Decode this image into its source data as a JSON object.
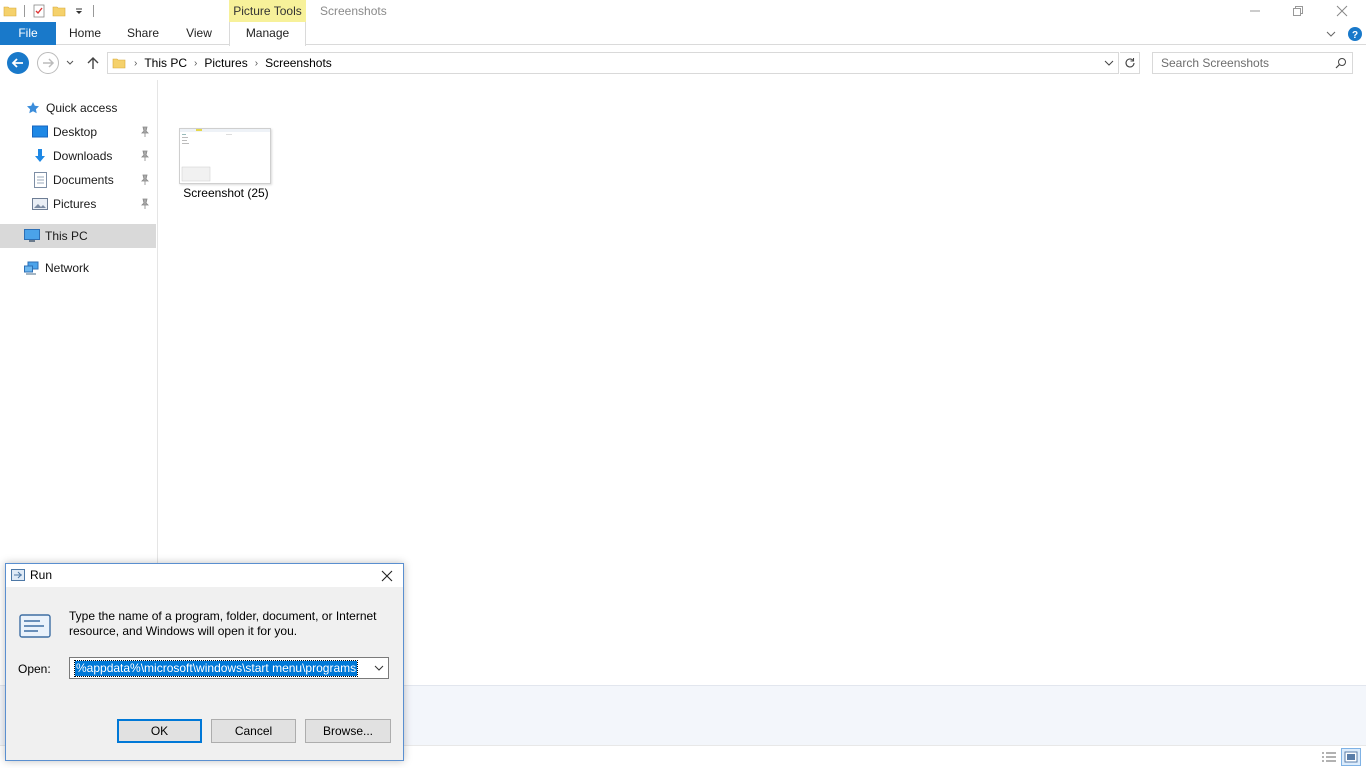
{
  "titlebar": {
    "context_tab": "Picture Tools",
    "window_title": "Screenshots"
  },
  "ribbon": {
    "tabs": [
      "File",
      "Home",
      "Share",
      "View",
      "Manage"
    ]
  },
  "address": {
    "crumbs": [
      "This PC",
      "Pictures",
      "Screenshots"
    ]
  },
  "search": {
    "placeholder": "Search Screenshots"
  },
  "sidebar": {
    "quick_access": "Quick access",
    "items": [
      "Desktop",
      "Downloads",
      "Documents",
      "Pictures"
    ],
    "this_pc": "This PC",
    "network": "Network"
  },
  "content": {
    "files": [
      {
        "name": "Screenshot (25)"
      }
    ]
  },
  "run_dialog": {
    "title": "Run",
    "description": "Type the name of a program, folder, document, or Internet resource, and Windows will open it for you.",
    "open_label": "Open:",
    "open_value": "%appdata%\\microsoft\\windows\\start menu\\programs",
    "ok_label": "OK",
    "cancel_label": "Cancel",
    "browse_label": "Browse..."
  },
  "colors": {
    "accent": "#1979ca",
    "context_tab": "#f7f19a",
    "selection": "#0078d7"
  }
}
